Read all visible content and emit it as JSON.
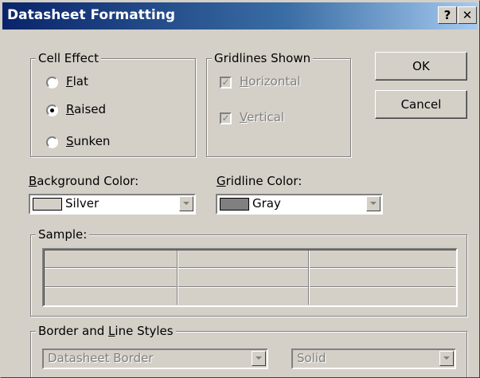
{
  "dialog": {
    "title": "Datasheet Formatting",
    "help_glyph": "?",
    "close_glyph": "✕"
  },
  "cell_effect": {
    "title": "Cell Effect",
    "options": [
      {
        "label_mnemonic": "F",
        "label_rest": "lat",
        "selected": false
      },
      {
        "label_mnemonic": "R",
        "label_rest": "aised",
        "selected": true
      },
      {
        "label_mnemonic": "S",
        "label_rest": "unken",
        "selected": false
      }
    ]
  },
  "gridlines_shown": {
    "title": "Gridlines Shown",
    "horizontal": {
      "label_mnemonic": "H",
      "label_rest": "orizontal",
      "checked": true,
      "enabled": false
    },
    "vertical": {
      "label_mnemonic": "V",
      "label_rest": "ertical",
      "checked": true,
      "enabled": false
    }
  },
  "buttons": {
    "ok_label": "OK",
    "cancel_label": "Cancel"
  },
  "background_color": {
    "label_mnemonic": "B",
    "label_rest": "ackground Color:",
    "value": "Silver",
    "swatch_color": "#d4d0c8"
  },
  "gridline_color": {
    "label_mnemonic": "G",
    "label_rest": "ridline Color:",
    "value": "Gray",
    "swatch_color": "#808080"
  },
  "sample": {
    "title": "Sample:"
  },
  "border_line_styles": {
    "title_pre": "Border and ",
    "title_mnemonic": "L",
    "title_rest": "ine Styles",
    "border_value": "Datasheet Border",
    "line_style_value": "Solid"
  },
  "colors": {
    "title_bar_start": "#0a246a",
    "title_bar_end": "#a6caf0",
    "dialog_face": "#d4d0c8"
  },
  "icons": {
    "help": "help-icon",
    "close": "close-icon",
    "dropdown": "chevron-down-icon",
    "checkmark": "checkmark-icon"
  }
}
